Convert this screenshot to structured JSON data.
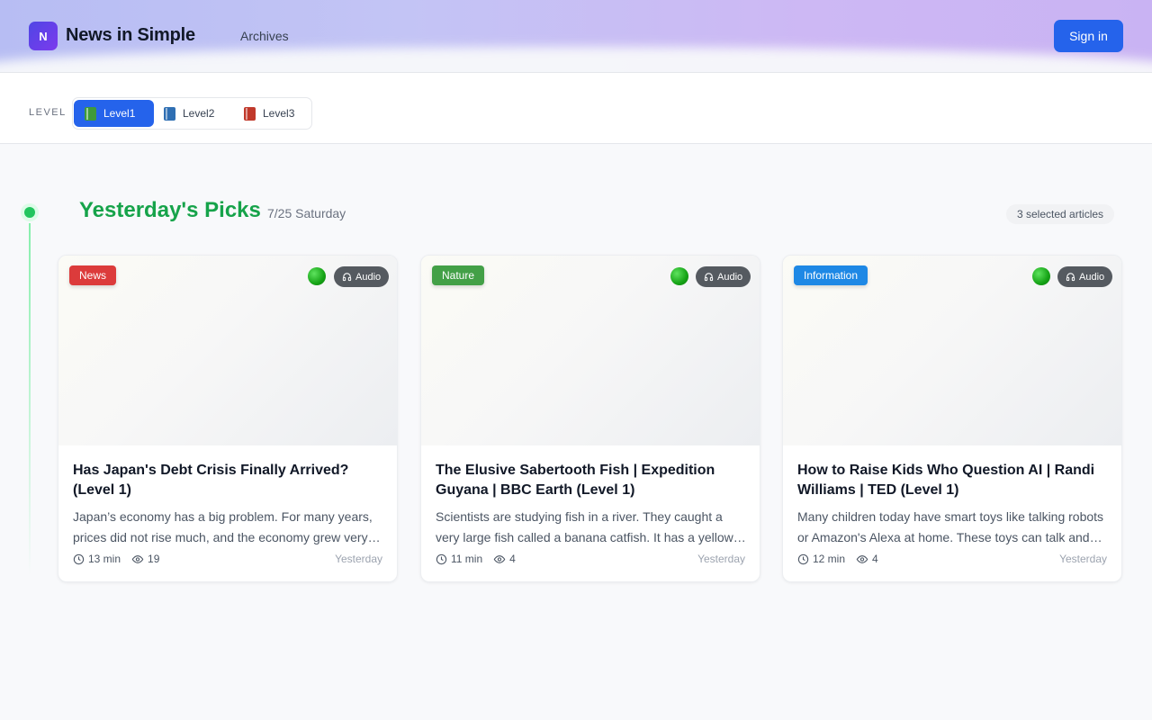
{
  "header": {
    "logo_letter": "N",
    "site_name": "News in Simple",
    "nav_archives": "Archives",
    "signin_label": "Sign in"
  },
  "level": {
    "label": "LEVEL",
    "options": [
      {
        "label": "Level1",
        "icon": "green-book-icon",
        "active": true
      },
      {
        "label": "Level2",
        "icon": "blue-book-icon",
        "active": false
      },
      {
        "label": "Level3",
        "icon": "red-book-icon",
        "active": false
      }
    ]
  },
  "section": {
    "title": "Yesterday's Picks",
    "date": "7/25 Saturday",
    "selected_count": "3 selected articles"
  },
  "colors": {
    "accent": "#2563eb",
    "section_green": "#16a34a",
    "tag_news": "#dc3b3b",
    "tag_nature": "#43a047",
    "tag_information": "#1e88e5"
  },
  "cards": [
    {
      "tag": "News",
      "audio_label": "Audio",
      "title": "Has Japan's Debt Crisis Finally Arrived? (Level 1)",
      "excerpt": "Japan’s economy has a big problem. For many years, prices did not rise much, and the economy grew very slowly.",
      "read_time": "13 min",
      "views": "19",
      "when": "Yesterday"
    },
    {
      "tag": "Nature",
      "audio_label": "Audio",
      "title": "The Elusive Sabertooth Fish | Expedition Guyana | BBC Earth (Level 1)",
      "excerpt": "Scientists are studying fish in a river. They caught a very large fish called a banana catfish. It has a yellow body.",
      "read_time": "11 min",
      "views": "4",
      "when": "Yesterday"
    },
    {
      "tag": "Information",
      "audio_label": "Audio",
      "title": "How to Raise Kids Who Question AI | Randi Williams | TED (Level 1)",
      "excerpt": "Many children today have smart toys like talking robots or Amazon's Alexa at home. These toys can talk and answer questions.",
      "read_time": "12 min",
      "views": "4",
      "when": "Yesterday"
    }
  ]
}
